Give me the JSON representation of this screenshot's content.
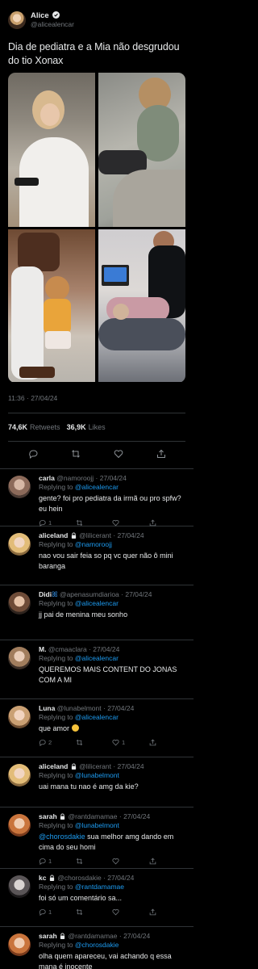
{
  "tweet": {
    "author_name": "Alice",
    "author_handle": "@alicealencar",
    "text": "Dia de pediatra e a Mia não desgrudou do tio Xonax",
    "timestamp": "11:36 · 27/04/24",
    "retweets_count": "74,6K",
    "retweets_label": "Retweets",
    "likes_count": "36,9K",
    "likes_label": "Likes",
    "photos": [
      "photo-woman-selfie",
      "photo-child-hand",
      "photo-woman-child",
      "photo-doctor-exam"
    ]
  },
  "colors": {
    "accent": "#1d9bf0",
    "background": "#000000",
    "muted": "#71767b"
  },
  "replies": [
    {
      "name": "carla",
      "handle": "@namoroojj",
      "date": "27/04/24",
      "locked": false,
      "replying_label": "Replying to",
      "replying_to": "@alicealencar",
      "text": "gente? foi pro pediatra da irmã ou pro spfw? eu hein",
      "reply_count": "1",
      "like_count": ""
    },
    {
      "name": "aliceland",
      "handle": "@lilicerant",
      "date": "27/04/24",
      "locked": true,
      "replying_label": "Replying to",
      "replying_to": "@namoroojj",
      "text": "nao vou sair feia so pq vc quer não ô mini baranga",
      "reply_count": "",
      "like_count": ""
    },
    {
      "name": "Didi",
      "handle": "@apenasumdiarioa",
      "date": "27/04/24",
      "locked": false,
      "replying_label": "Replying to",
      "replying_to": "@alicealencar",
      "text": "jj pai de menina meu sonho",
      "reply_count": "",
      "like_count": ""
    },
    {
      "name": "M.",
      "handle": "@cmaaclara",
      "date": "27/04/24",
      "locked": false,
      "replying_label": "Replying to",
      "replying_to": "@alicealencar",
      "text": "QUEREMOS MAIS CONTENT DO JONAS COM A MI",
      "reply_count": "",
      "like_count": ""
    },
    {
      "name": "Luna",
      "handle": "@lunabelmont",
      "date": "27/04/24",
      "locked": false,
      "replying_label": "Replying to",
      "replying_to": "@alicealencar",
      "text": "que amor",
      "reply_count": "2",
      "like_count": "1"
    },
    {
      "name": "aliceland",
      "handle": "@lilicerant",
      "date": "27/04/24",
      "locked": true,
      "replying_label": "Replying to",
      "replying_to": "@lunabelmont",
      "text": "uai mana tu nao é amg da kie?",
      "reply_count": "",
      "like_count": ""
    },
    {
      "name": "sarah",
      "handle": "@rantdamamae",
      "date": "27/04/24",
      "locked": true,
      "replying_label": "Replying to",
      "replying_to": "@lunabelmont",
      "text_mention": "@chorosdakie",
      "text": " sua melhor amg dando em cima do seu homi",
      "reply_count": "1",
      "like_count": ""
    },
    {
      "name": "kc",
      "handle": "@chorosdakie",
      "date": "27/04/24",
      "locked": true,
      "replying_label": "Replying to",
      "replying_to": "@rantdamamae",
      "text": "foi só um comentário sa...",
      "reply_count": "1",
      "like_count": ""
    },
    {
      "name": "sarah",
      "handle": "@rantdamamae",
      "date": "27/04/24",
      "locked": true,
      "replying_label": "Replying to",
      "replying_to": "@chorosdakie",
      "text": "olha quem apareceu, vai achando q essa mana é inocente",
      "reply_count": "",
      "like_count": ""
    }
  ]
}
